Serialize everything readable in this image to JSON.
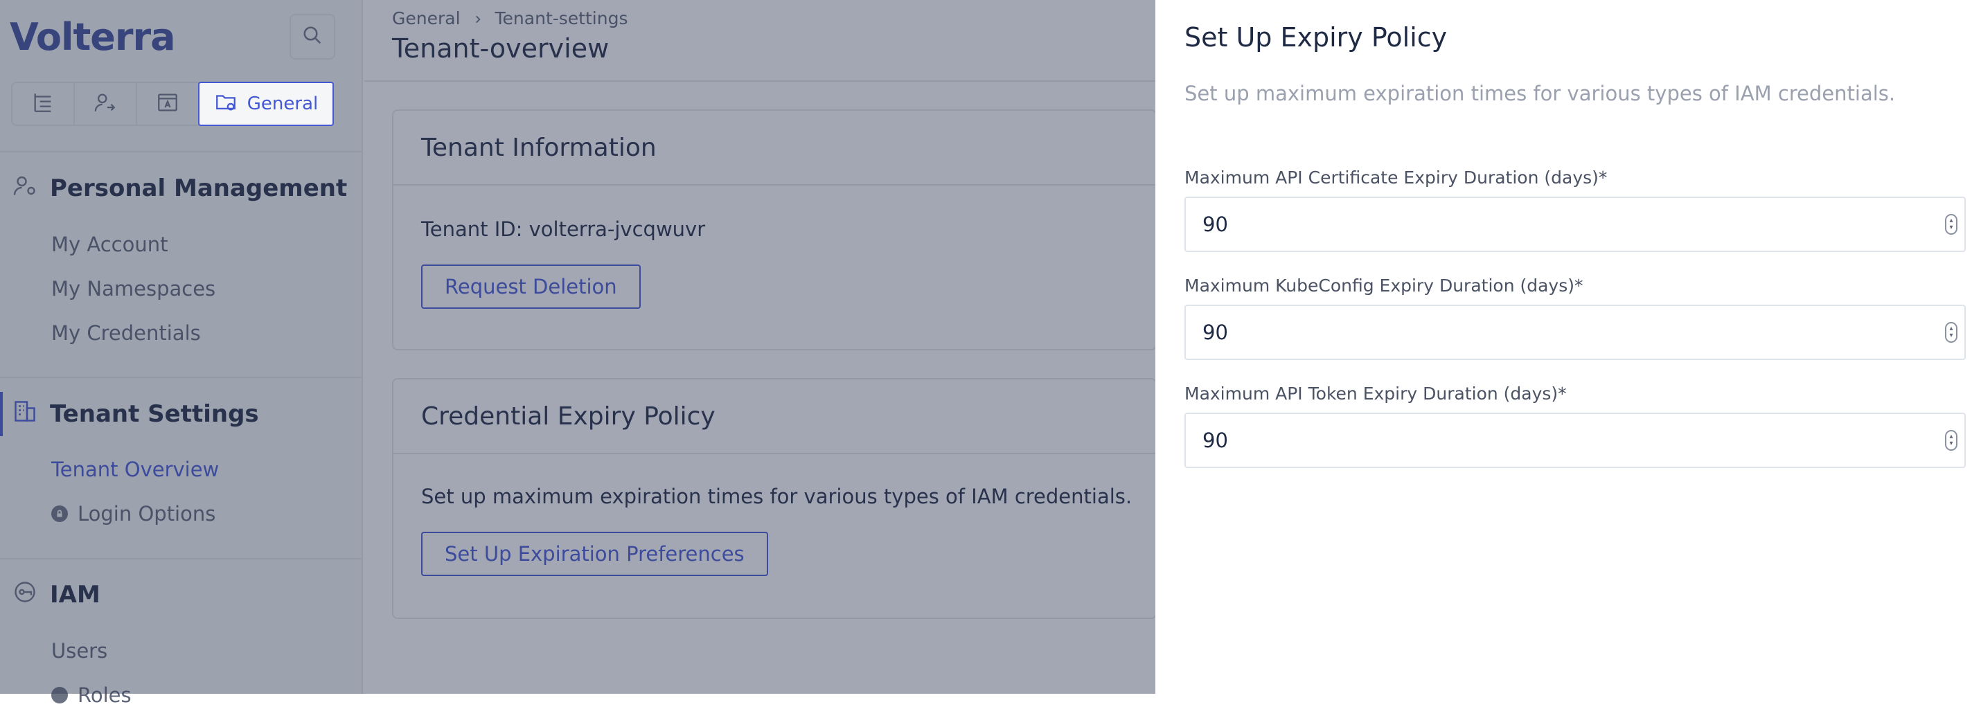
{
  "app": {
    "logo_text": "Volterra"
  },
  "sidebar": {
    "tabs": [
      {
        "icon": "list-tree-icon"
      },
      {
        "icon": "user-share-icon"
      },
      {
        "icon": "app-window-icon"
      },
      {
        "icon": "folder-gear-icon",
        "label": "General"
      }
    ],
    "sections": [
      {
        "title": "Personal Management",
        "icon": "person-gear-icon",
        "items": [
          "My Account",
          "My Namespaces",
          "My Credentials"
        ]
      },
      {
        "title": "Tenant Settings",
        "icon": "building-icon",
        "items": [
          "Tenant Overview",
          "Login Options"
        ]
      },
      {
        "title": "IAM",
        "icon": "key-icon",
        "items": [
          "Users",
          "Roles"
        ]
      }
    ]
  },
  "header": {
    "breadcrumb": [
      "General",
      "Tenant-settings"
    ],
    "title": "Tenant-overview"
  },
  "main": {
    "tenant_info": {
      "title": "Tenant Information",
      "tenant_id_text": "Tenant ID: volterra-jvcqwuvr",
      "button": "Request Deletion"
    },
    "expiry_policy": {
      "title": "Credential Expiry Policy",
      "description": "Set up maximum expiration times for various types of IAM credentials.",
      "button": "Set Up Expiration Preferences"
    }
  },
  "drawer": {
    "title": "Set Up Expiry Policy",
    "description": "Set up maximum expiration times for various types of IAM credentials.",
    "fields": [
      {
        "label": "Maximum API Certificate Expiry Duration (days)*",
        "value": "90"
      },
      {
        "label": "Maximum KubeConfig Expiry Duration (days)*",
        "value": "90"
      },
      {
        "label": "Maximum API Token Expiry Duration (days)*",
        "value": "90"
      }
    ]
  },
  "colors": {
    "accent": "#4458d4",
    "text": "#1f2a44",
    "muted": "#5d6577",
    "overlay": "#343c56"
  }
}
